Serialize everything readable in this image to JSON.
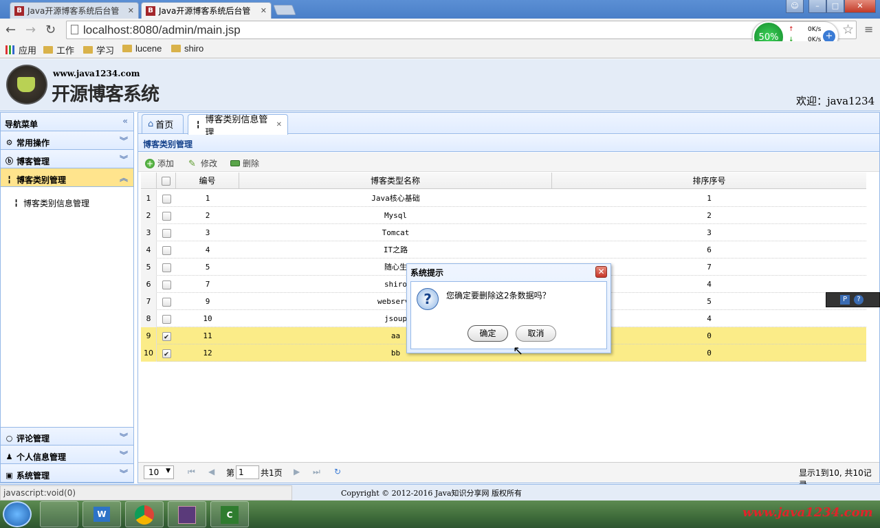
{
  "browser": {
    "tabs": [
      {
        "title": "Java开源博客系统后台管",
        "active": false
      },
      {
        "title": "Java开源博客系统后台管",
        "active": true
      }
    ],
    "address": "localhost:8080/admin/main.jsp",
    "bookmarks": [
      "应用",
      "工作",
      "学习",
      "lucene",
      "shiro"
    ],
    "speed": {
      "percent": "50%",
      "up": "0K/s",
      "down": "0K/s"
    }
  },
  "header": {
    "site": "www.java1234.com",
    "title": "开源博客系统",
    "welcome": "欢迎：java1234"
  },
  "nav": {
    "title": "导航菜单",
    "sections": [
      {
        "label": "常用操作"
      },
      {
        "label": "博客管理"
      },
      {
        "label": "博客类别管理"
      },
      {
        "label": "评论管理"
      },
      {
        "label": "个人信息管理"
      },
      {
        "label": "系统管理"
      }
    ],
    "sub_item": "博客类别信息管理"
  },
  "tabs": {
    "home": "首页",
    "current": "博客类别信息管理"
  },
  "panel": {
    "title": "博客类别管理",
    "add": "添加",
    "edit": "修改",
    "delete": "删除"
  },
  "table": {
    "headers": [
      "编号",
      "博客类型名称",
      "排序序号"
    ],
    "rows": [
      {
        "rn": "1",
        "id": "1",
        "name": "Java核心基础",
        "order": "1",
        "checked": false
      },
      {
        "rn": "2",
        "id": "2",
        "name": "Mysql",
        "order": "2",
        "checked": false
      },
      {
        "rn": "3",
        "id": "3",
        "name": "Tomcat",
        "order": "3",
        "checked": false
      },
      {
        "rn": "4",
        "id": "4",
        "name": "IT之路",
        "order": "6",
        "checked": false
      },
      {
        "rn": "5",
        "id": "5",
        "name": "随心生",
        "order": "7",
        "checked": false
      },
      {
        "rn": "6",
        "id": "7",
        "name": "shiro",
        "order": "4",
        "checked": false
      },
      {
        "rn": "7",
        "id": "9",
        "name": "webservi",
        "order": "5",
        "checked": false
      },
      {
        "rn": "8",
        "id": "10",
        "name": "jsoup",
        "order": "4",
        "checked": false
      },
      {
        "rn": "9",
        "id": "11",
        "name": "aa",
        "order": "0",
        "checked": true
      },
      {
        "rn": "10",
        "id": "12",
        "name": "bb",
        "order": "0",
        "checked": true
      }
    ]
  },
  "pager": {
    "page_size": "10",
    "page_prefix": "第",
    "page": "1",
    "page_total": "共1页",
    "summary": "显示1到10, 共10记录"
  },
  "footer": {
    "copyright": "Copyright © 2012-2016 Java知识分享网 版权所有"
  },
  "status": "javascript:void(0)",
  "watermark": "www.java1234.com",
  "dialog": {
    "title": "系统提示",
    "message": "您确定要删除这2条数据吗？",
    "ok": "确定",
    "cancel": "取消"
  }
}
